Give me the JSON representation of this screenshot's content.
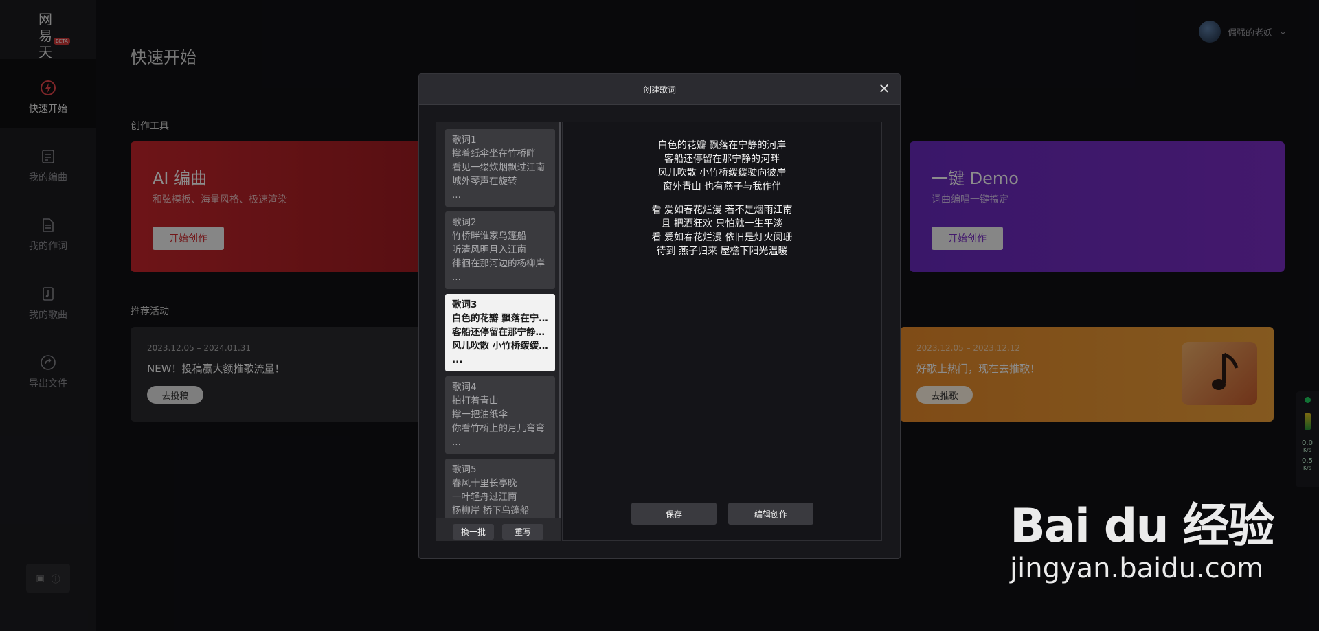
{
  "sidebar": {
    "logo_text": "网易天音",
    "logo_badge": "BETA",
    "items": [
      {
        "label": "快速开始",
        "icon": "lightning-icon",
        "active": true
      },
      {
        "label": "我的编曲",
        "icon": "score-icon"
      },
      {
        "label": "我的作词",
        "icon": "document-icon"
      },
      {
        "label": "我的歌曲",
        "icon": "music-file-icon"
      },
      {
        "label": "导出文件",
        "icon": "export-icon"
      }
    ],
    "bottom_icons": [
      "book-icon",
      "help-icon"
    ]
  },
  "header": {
    "page_title": "快速开始",
    "user_name": "倔强的老妖"
  },
  "sections": {
    "tools_label": "创作工具",
    "activities_label": "推荐活动"
  },
  "tools": [
    {
      "title": "AI 编曲",
      "subtitle": "和弦模板、海量风格、极速渲染",
      "button": "开始创作",
      "color": "#c8262c"
    },
    {
      "title": "一键 Demo",
      "subtitle": "词曲编唱一键搞定",
      "button": "开始创作",
      "color": "#7b2ec6"
    }
  ],
  "activities": [
    {
      "date": "2023.12.05 – 2024.01.31",
      "title": "NEW！投稿赢大额推歌流量！",
      "button": "去投稿"
    },
    {
      "date": "2023.12.05 – 2023.12.12",
      "title": "好歌上热门，现在去推歌！",
      "button": "去推歌",
      "color": "#f0a23a"
    }
  ],
  "net_widget": {
    "up": "0.0",
    "down": "0.5",
    "unit": "K/s"
  },
  "modal": {
    "title": "创建歌词",
    "close_icon": "close-icon",
    "lyric_cards": [
      {
        "title": "歌词1",
        "lines": [
          "撑着纸伞坐在竹桥畔",
          "看见一缕炊烟飘过江南",
          "城外琴声在旋转"
        ],
        "more": "..."
      },
      {
        "title": "歌词2",
        "lines": [
          "竹桥畔谁家乌篷船",
          "听清风明月入江南",
          "徘徊在那河边的杨柳岸"
        ],
        "more": "..."
      },
      {
        "title": "歌词3",
        "lines": [
          "白色的花瓣 飘落在宁静的河岸",
          "客船还停留在那宁静的河畔",
          "风儿吹散 小竹桥缓缓驶向彼岸"
        ],
        "more": "...",
        "active": true
      },
      {
        "title": "歌词4",
        "lines": [
          "拍打着青山",
          "撑一把油纸伞",
          "你看竹桥上的月儿弯弯"
        ],
        "more": "..."
      },
      {
        "title": "歌词5",
        "lines": [
          "春风十里长亭晚",
          "一叶轻舟过江南",
          "杨柳岸 桥下乌篷船"
        ],
        "more": "..."
      }
    ],
    "swap_button": "换一批",
    "rewrite_button": "重写",
    "preview_stanzas": [
      [
        "白色的花瓣 飘落在宁静的河岸",
        "客船还停留在那宁静的河畔",
        "风儿吹散 小竹桥缓缓驶向彼岸",
        "窗外青山 也有燕子与我作伴"
      ],
      [
        "看 爱如春花烂漫 若不是烟雨江南",
        "且 把酒狂欢 只怕就一生平淡",
        "看 爱如春花烂漫 依旧是灯火阑珊",
        "待到 燕子归来 屋檐下阳光温暖"
      ]
    ],
    "save_button": "保存",
    "edit_button": "编辑创作"
  },
  "watermark": {
    "brand": "Bai du 经验",
    "url": "jingyan.baidu.com"
  }
}
